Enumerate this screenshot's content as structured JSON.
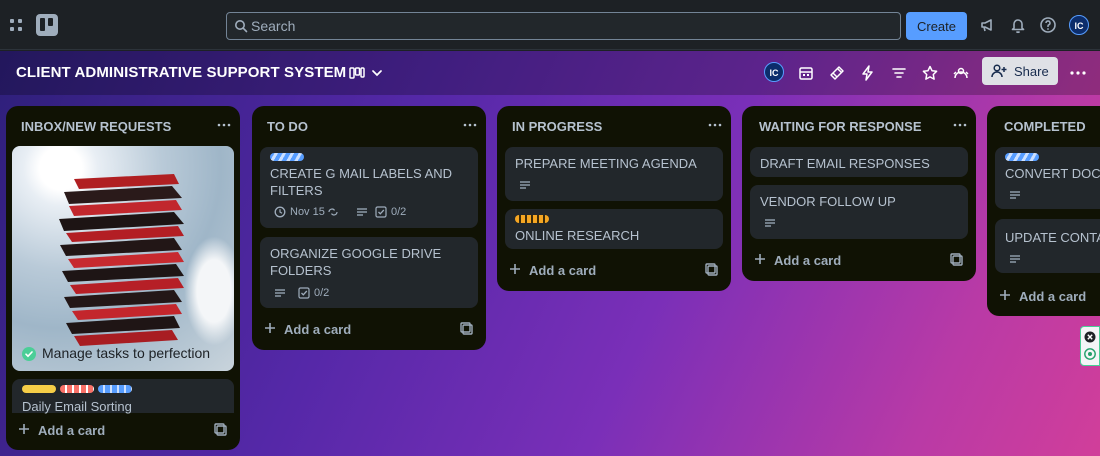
{
  "topnav": {
    "search_placeholder": "Search",
    "create_label": "Create",
    "user_initials": "IC"
  },
  "board": {
    "title": "CLIENT ADMINISTRATIVE SUPPORT SYSTEM",
    "share_label": "Share",
    "member_initials": "IC"
  },
  "colors": {
    "accent": "#579dff",
    "list_bg": "#101204",
    "card_bg": "#22272b",
    "board_gradient_start": "#2e1f7a",
    "board_gradient_end": "#d13e9a"
  },
  "lists": [
    {
      "title": "INBOX/NEW REQUESTS",
      "add_card_label": "Add a card",
      "cards": [
        {
          "cover_caption": "Manage tasks to perfection"
        },
        {
          "title": "Daily Email Sorting",
          "labels": [
            "yellow",
            "red",
            "blue"
          ]
        }
      ]
    },
    {
      "title": "TO DO",
      "add_card_label": "Add a card",
      "cards": [
        {
          "title_line1": "CREATE G MAIL LABELS AND",
          "title_line2": "FILTERS",
          "labels": [
            "blue-stripe"
          ],
          "due": "Nov 15",
          "checklist": "0/2"
        },
        {
          "title_line1": "ORGANIZE GOOGLE DRIVE",
          "title_line2": "FOLDERS",
          "checklist": "0/2"
        }
      ]
    },
    {
      "title": "IN PROGRESS",
      "add_card_label": "Add a card",
      "cards": [
        {
          "title": "PREPARE MEETING AGENDA"
        },
        {
          "title": "ONLINE RESEARCH",
          "labels": [
            "orange-stripe"
          ]
        }
      ]
    },
    {
      "title": "WAITING FOR RESPONSE",
      "add_card_label": "Add a card",
      "cards": [
        {
          "title": "DRAFT EMAIL RESPONSES"
        },
        {
          "title": "VENDOR FOLLOW UP"
        }
      ]
    },
    {
      "title": "COMPLETED",
      "add_card_label": "Add a card",
      "cards": [
        {
          "title": "CONVERT DOCU",
          "labels": [
            "blue-stripe"
          ]
        },
        {
          "title": "UPDATE CONTAC"
        }
      ]
    }
  ]
}
